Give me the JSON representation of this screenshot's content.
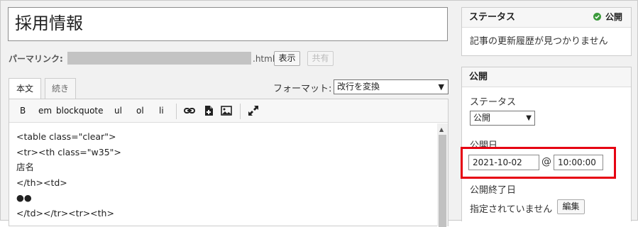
{
  "post": {
    "title": "採用情報",
    "permalink_label": "パーマリンク:",
    "permalink_suffix": ".html",
    "view_button": "表示",
    "share_button": "共有"
  },
  "editor": {
    "tabs": [
      "本文",
      "続き"
    ],
    "format_label": "フォーマット:",
    "format_value": "改行を変換",
    "toolbar": [
      "B",
      "em",
      "blockquote",
      "ul",
      "ol",
      "li"
    ],
    "icons": [
      "link-icon",
      "insert-file-icon",
      "insert-image-icon",
      "fullscreen-icon"
    ],
    "code_lines": [
      "<table class=\"clear\">",
      "<tr><th class=\"w35\">",
      "店名",
      "</th><td>",
      "●●",
      "</td></tr><tr><th>"
    ]
  },
  "status_panel": {
    "title": "ステータス",
    "badge": "公開",
    "badge_color": "#3c9a3c",
    "message": "記事の更新履歴が見つかりません"
  },
  "publish_panel": {
    "title": "公開",
    "status_label": "ステータス",
    "status_value": "公開",
    "date_label": "公開日",
    "date_value": "2021-10-02",
    "at": "@",
    "time_value": "10:00:00",
    "end_label": "公開終了日",
    "end_value": "指定されていません",
    "edit_button": "編集"
  },
  "highlight_color": "#e60012"
}
